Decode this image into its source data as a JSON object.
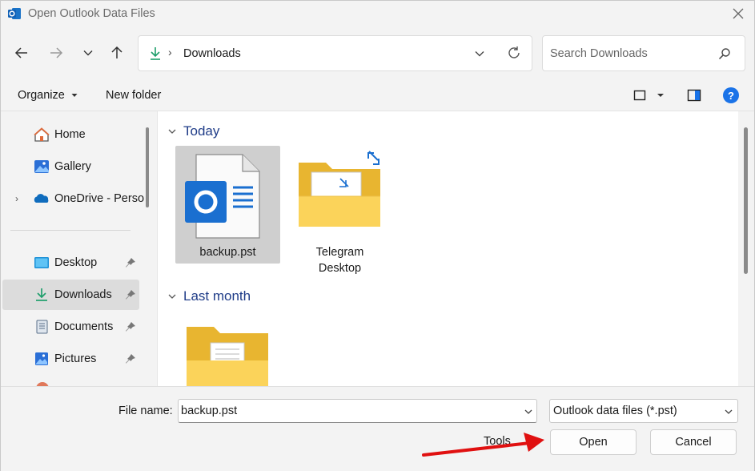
{
  "window": {
    "title": "Open Outlook Data Files"
  },
  "nav": {
    "address_location": "Downloads",
    "search_placeholder": "Search Downloads"
  },
  "commands": {
    "organize": "Organize",
    "new_folder": "New folder"
  },
  "sidebar": {
    "items": [
      {
        "label": "Home",
        "icon": "home-icon"
      },
      {
        "label": "Gallery",
        "icon": "gallery-icon"
      },
      {
        "label": "OneDrive - Perso",
        "icon": "onedrive-icon"
      },
      {
        "label": "Desktop",
        "icon": "desktop-icon",
        "pinned": true
      },
      {
        "label": "Downloads",
        "icon": "downloads-icon",
        "pinned": true,
        "selected": true
      },
      {
        "label": "Documents",
        "icon": "documents-icon",
        "pinned": true
      },
      {
        "label": "Pictures",
        "icon": "pictures-icon",
        "pinned": true
      }
    ]
  },
  "content": {
    "groups": [
      {
        "header": "Today",
        "files": [
          {
            "name": "backup.pst",
            "icon": "outlook-file-icon",
            "selected": true
          },
          {
            "name": "Telegram Desktop",
            "icon": "folder-icon"
          }
        ]
      },
      {
        "header": "Last month",
        "files": [
          {
            "name": "",
            "icon": "folder-icon"
          }
        ]
      }
    ]
  },
  "footer": {
    "file_name_label": "File name:",
    "file_name_value": "backup.pst",
    "file_type": "Outlook data files (*.pst)",
    "tools": "Tools",
    "open": "Open",
    "cancel": "Cancel"
  },
  "colors": {
    "accent": "#1a73e8",
    "group_header": "#1f3c88",
    "folder": "#f7c948",
    "annotation_arrow": "#e01010"
  }
}
